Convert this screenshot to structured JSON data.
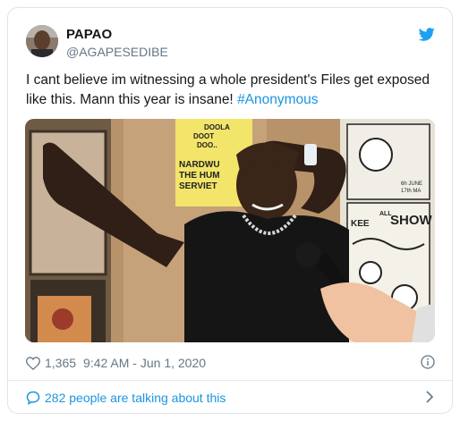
{
  "tweet": {
    "display_name": "PAPAO",
    "handle": "@AGAPESEDIBE",
    "text": "I cant believe im witnessing a whole president's Files get exposed like this. Mann this year is insane! ",
    "hashtag": "#Anonymous",
    "likes": "1,365",
    "timestamp": "9:42 AM - Jun 1, 2020",
    "talking": "282 people are talking about this"
  },
  "poster": {
    "line1": "DOOLA",
    "line2": "DOOT",
    "line3": "DOO..",
    "headline1": "NARDWU",
    "headline2": "THE HUM",
    "headline3": "SERVIET",
    "right_small1": "6h JUNE",
    "right_small2": "17th MA",
    "right_banner": "ALL",
    "right_show": "SHOW",
    "right_kee": "KEE"
  },
  "colors": {
    "accent": "#1b95e0",
    "text": "#14171a",
    "secondary": "#657786"
  }
}
